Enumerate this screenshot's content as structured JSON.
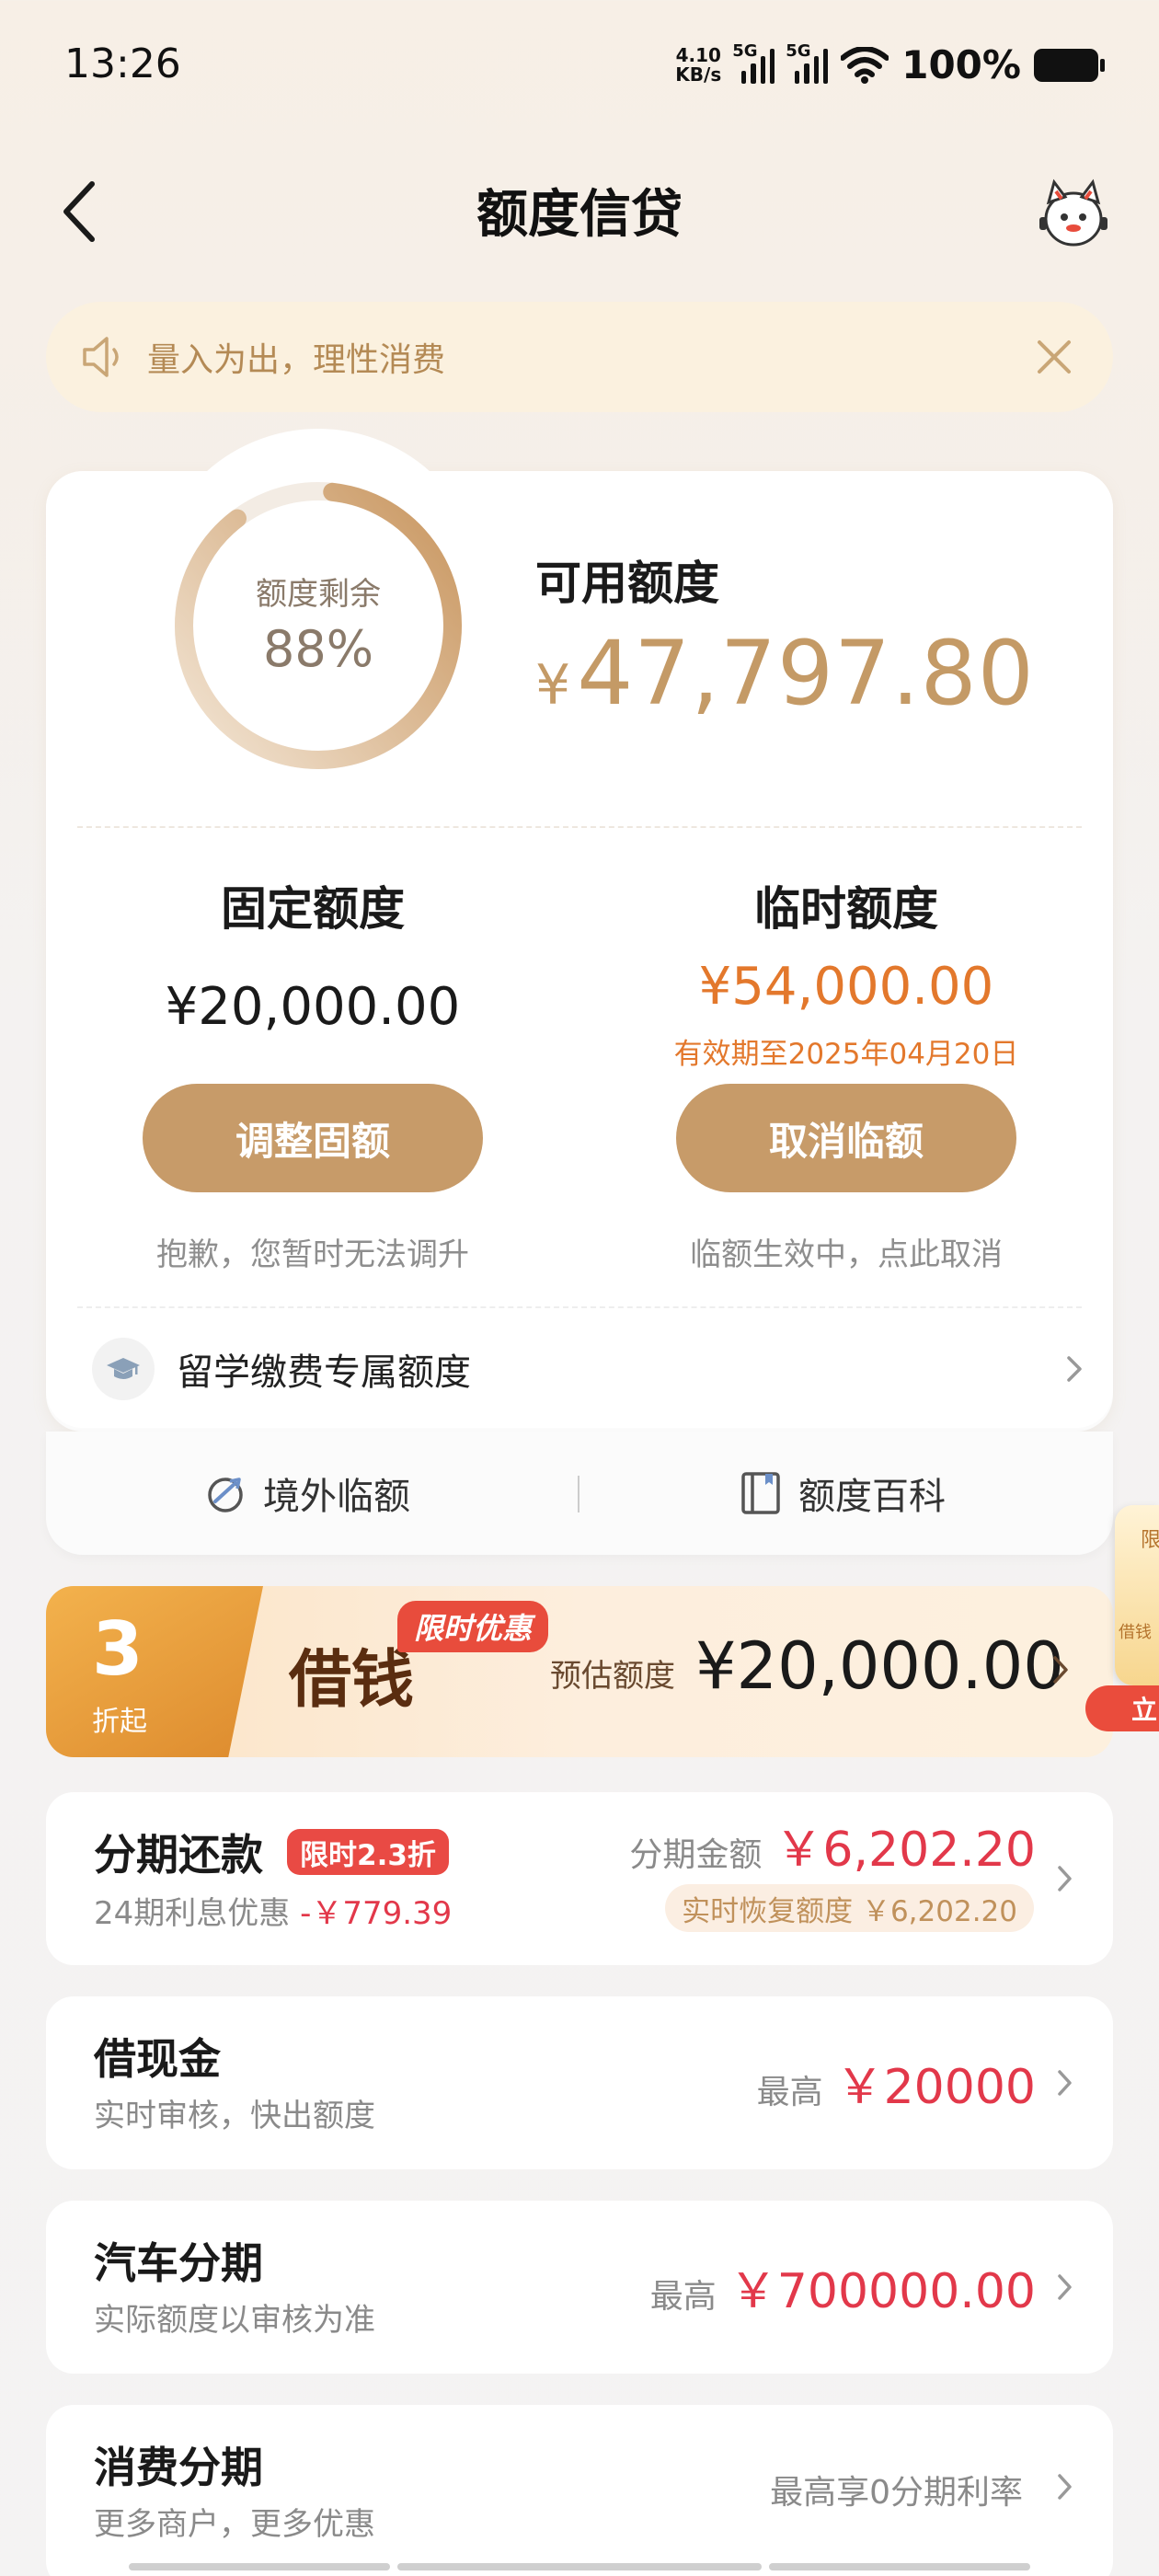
{
  "status_bar": {
    "time": "13:26",
    "net_speed_value": "4.10",
    "net_speed_unit": "KB/s",
    "signal_1_tag": "5G",
    "signal_2_tag": "5G",
    "battery_pct": "100%"
  },
  "header": {
    "title": "额度信贷",
    "back_icon": "chevron-left-icon",
    "mascot_icon": "mascot-icon"
  },
  "notice": {
    "text": "量入为出，理性消费",
    "icon": "speaker-icon",
    "close_icon": "close-icon"
  },
  "credit": {
    "ring_label": "额度剩余",
    "ring_pct_text": "88%",
    "ring_fraction": 0.88,
    "available_label": "可用额度",
    "available_currency": "¥",
    "available_value": "47,797.80",
    "fixed": {
      "title": "固定额度",
      "value": "¥20,000.00",
      "button": "调整固额",
      "note": "抱歉，您暂时无法调升"
    },
    "temporary": {
      "title": "临时额度",
      "value": "¥54,000.00",
      "expiry": "有效期至2025年04月20日",
      "button": "取消临额",
      "note": "临额生效中，点此取消"
    },
    "study_abroad_label": "留学缴费专属额度",
    "overseas_temp_label": "境外临额",
    "credit_wiki_label": "额度百科"
  },
  "promo": {
    "discount_number": "3",
    "discount_suffix": "折起",
    "borrow_label": "借钱",
    "limited_tag": "限时优惠",
    "estimate_label": "预估额度",
    "estimate_value": "¥20,000.00"
  },
  "side_float": {
    "text_top": "限",
    "text_mid": "借钱",
    "button": "立"
  },
  "list": [
    {
      "title": "分期还款",
      "tag": "限时2.3折",
      "sub_prefix": "24期利息优惠 ",
      "sub_discount": "-￥779.39",
      "right_prefix": "分期金额",
      "right_amount": "￥6,202.20",
      "restore_tag": "实时恢复额度 ￥6,202.20"
    },
    {
      "title": "借现金",
      "sub": "实时审核，快出额度",
      "right_prefix": "最高",
      "right_amount": "￥20000"
    },
    {
      "title": "汽车分期",
      "sub": "实际额度以审核为准",
      "right_prefix": "最高",
      "right_amount": "￥700000.00"
    },
    {
      "title": "消费分期",
      "sub": "更多商户，更多优惠",
      "right_prefix": "最高享0分期利率",
      "right_amount": ""
    }
  ],
  "colors": {
    "gold": "#c79b69",
    "gold_text": "#c49a66",
    "orange": "#e3782c",
    "red": "#e2384a"
  }
}
